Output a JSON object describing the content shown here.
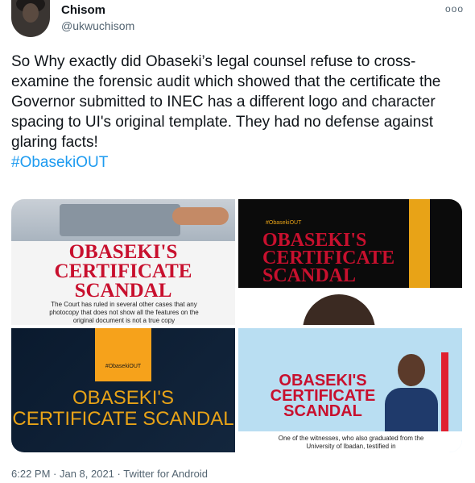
{
  "tweet": {
    "name": "Chisom",
    "handle": "@ukwuchisom",
    "more_icon": "more-icon",
    "text": "So Why exactly did Obaseki’s legal counsel refuse to cross-examine the forensic audit which showed that the certificate the Governor submitted to INEC has a different logo and character spacing to UI's original template. They had no defense against glaring facts!",
    "hashtag": "#ObasekiOUT",
    "timestamp": "6:22 PM · Jan 8, 2021 · Twitter for Android"
  },
  "images": [
    {
      "title": "OBASEKI'S CERTIFICATE SCANDAL",
      "caption": "The Court has ruled in several other cases that any photocopy that does not show all the features on the original document is not a true copy"
    },
    {
      "tag": "#ObasekiOUT",
      "title": "OBASEKI'S CERTIFICATE SCANDAL"
    },
    {
      "tag": "#ObasekiOUT",
      "title": "OBASEKI'S CERTIFICATE SCANDAL"
    },
    {
      "title": "OBASEKI'S CERTIFICATE SCANDAL",
      "caption": "One of the witnesses, who also graduated from the University of Ibadan, testified in"
    }
  ],
  "colors": {
    "link": "#1d9bf0",
    "red": "#c8102e",
    "gold": "#e8a317"
  }
}
